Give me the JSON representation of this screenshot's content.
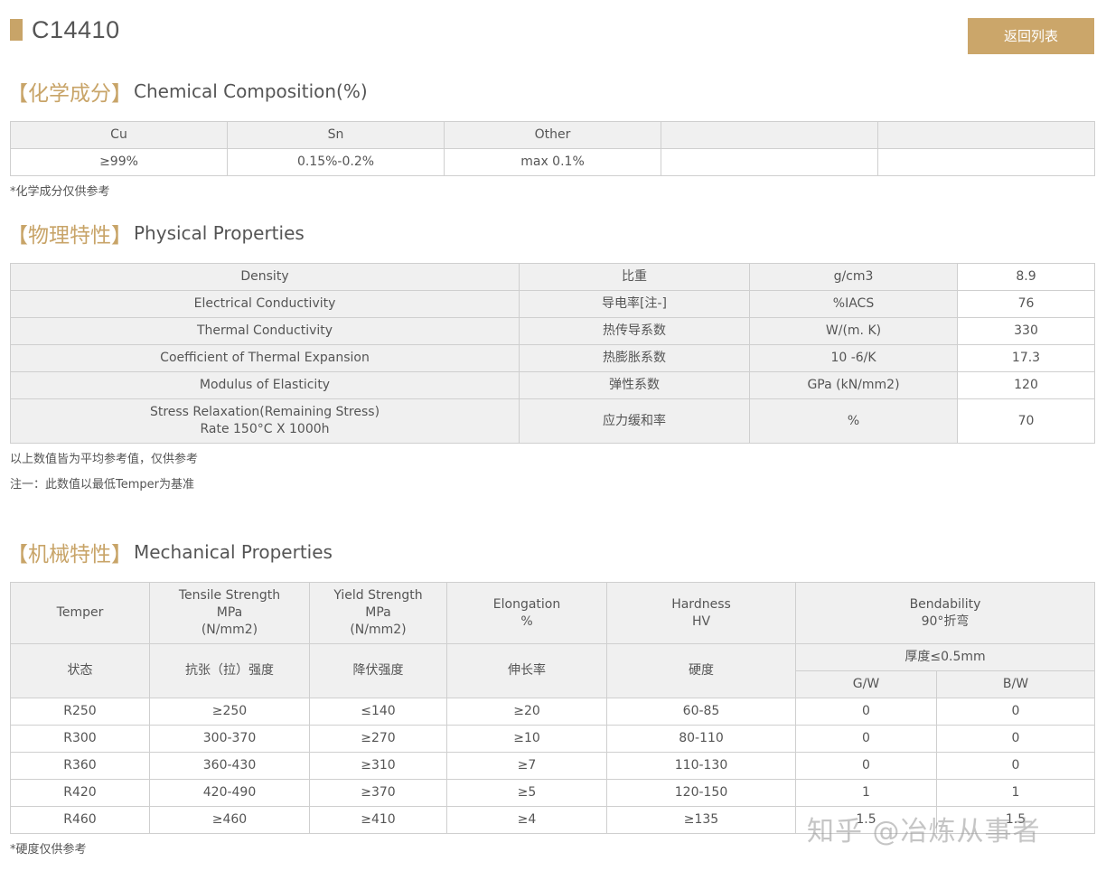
{
  "header": {
    "title": "C14410",
    "back_button": "返回列表"
  },
  "chemical": {
    "heading_cn": "【化学成分】",
    "heading_en": "Chemical Composition(%)",
    "columns": [
      "Cu",
      "Sn",
      "Other",
      "",
      ""
    ],
    "values": [
      "≥99%",
      "0.15%-0.2%",
      "max 0.1%",
      "",
      ""
    ],
    "note": "*化学成分仅供参考"
  },
  "physical": {
    "heading_cn": "【物理特性】",
    "heading_en": "Physical Properties",
    "rows": [
      {
        "name": "Density",
        "cn": "比重",
        "unit": "g/cm3",
        "value": "8.9"
      },
      {
        "name": "Electrical Conductivity",
        "cn": "导电率[注-]",
        "unit": "%IACS",
        "value": "76"
      },
      {
        "name": "Thermal Conductivity",
        "cn": "热传导系数",
        "unit": "W/(m. K)",
        "value": "330"
      },
      {
        "name": "Coefficient of Thermal Expansion",
        "cn": "热膨胀系数",
        "unit": "10 -6/K",
        "value": "17.3"
      },
      {
        "name": "Modulus of Elasticity",
        "cn": "弹性系数",
        "unit": "GPa (kN/mm2)",
        "value": "120"
      },
      {
        "name": "Stress Relaxation(Remaining Stress)",
        "name2": "Rate 150°C X 1000h",
        "cn": "应力缓和率",
        "unit": "%",
        "value": "70"
      }
    ],
    "note1": "以上数值皆为平均参考值，仅供参考",
    "note2": "注一：此数值以最低Temper为基准"
  },
  "mechanical": {
    "heading_cn": "【机械特性】",
    "heading_en": "Mechanical Properties",
    "headers": {
      "temper": "Temper",
      "tensile": [
        "Tensile Strength",
        "MPa",
        "(N/mm2)"
      ],
      "yield": [
        "Yield Strength",
        "MPa",
        "(N/mm2)"
      ],
      "elongation": [
        "Elongation",
        "%"
      ],
      "hardness": [
        "Hardness",
        "HV"
      ],
      "bend": [
        "Bendability",
        "90°折弯"
      ],
      "temper_cn": "状态",
      "tensile_cn": "抗张（拉）强度",
      "yield_cn": "降伏强度",
      "elongation_cn": "伸长率",
      "hardness_cn": "硬度",
      "thickness": "厚度≤0.5mm",
      "gw": "G/W",
      "bw": "B/W"
    },
    "rows": [
      [
        "R250",
        "≥250",
        "≤140",
        "≥20",
        "60-85",
        "0",
        "0"
      ],
      [
        "R300",
        "300-370",
        "≥270",
        "≥10",
        "80-110",
        "0",
        "0"
      ],
      [
        "R360",
        "360-430",
        "≥310",
        "≥7",
        "110-130",
        "0",
        "0"
      ],
      [
        "R420",
        "420-490",
        "≥370",
        "≥5",
        "120-150",
        "1",
        "1"
      ],
      [
        "R460",
        "≥460",
        "≥410",
        "≥4",
        "≥135",
        "1.5",
        "1.5"
      ]
    ],
    "note": "*硬度仅供参考"
  },
  "watermark": "知乎 @冶炼从事者",
  "colors": {
    "accent": "#c8a468",
    "button": "#cba66a",
    "header_bg": "#f0f0f0",
    "border": "#cfcfcf"
  }
}
